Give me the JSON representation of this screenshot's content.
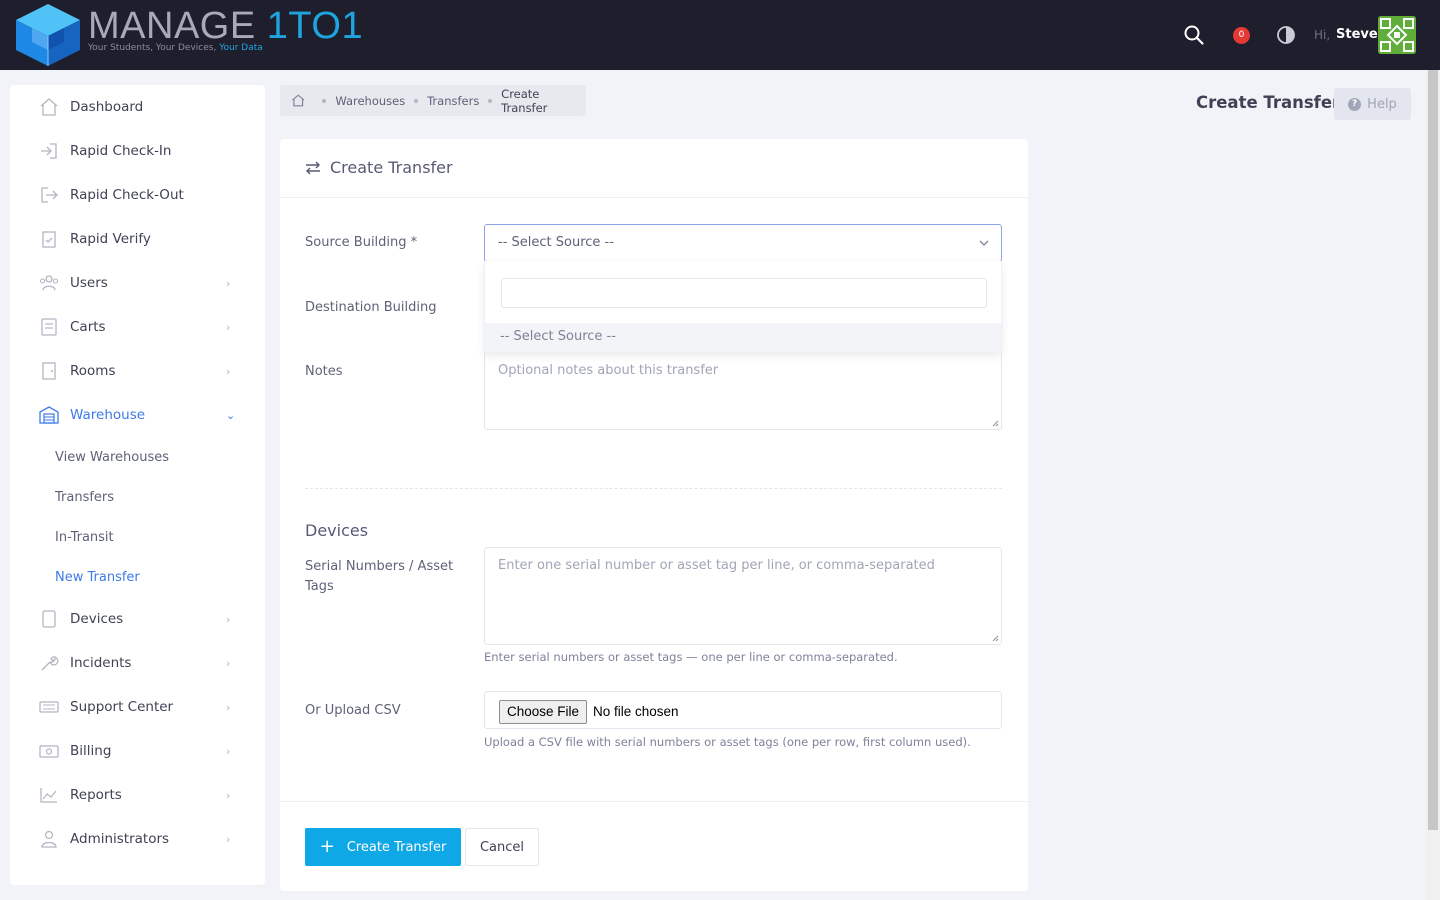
{
  "header": {
    "logo_main": "MANAGE",
    "logo_accent": "1TO1",
    "logo_tag": "Your Students, Your Devices,",
    "logo_tag_accent": "Your Data",
    "notification_count": "0",
    "greeting": "Hi,",
    "user_name": "Steve"
  },
  "sidebar": {
    "items": [
      {
        "label": "Dashboard",
        "icon": "home-icon"
      },
      {
        "label": "Rapid Check-In",
        "icon": "sign-in-icon"
      },
      {
        "label": "Rapid Check-Out",
        "icon": "sign-out-icon"
      },
      {
        "label": "Rapid Verify",
        "icon": "clipboard-check-icon"
      },
      {
        "label": "Users",
        "icon": "users-icon"
      },
      {
        "label": "Carts",
        "icon": "cart-icon"
      },
      {
        "label": "Rooms",
        "icon": "door-icon"
      },
      {
        "label": "Warehouse",
        "icon": "warehouse-icon"
      },
      {
        "label": "Devices",
        "icon": "tablet-icon"
      },
      {
        "label": "Incidents",
        "icon": "wrench-icon"
      },
      {
        "label": "Support Center",
        "icon": "ticket-icon"
      },
      {
        "label": "Billing",
        "icon": "money-icon"
      },
      {
        "label": "Reports",
        "icon": "chart-icon"
      },
      {
        "label": "Administrators",
        "icon": "admin-icon"
      }
    ],
    "warehouse_sub": [
      {
        "label": "View Warehouses"
      },
      {
        "label": "Transfers"
      },
      {
        "label": "In-Transit"
      },
      {
        "label": "New Transfer"
      }
    ]
  },
  "breadcrumb": {
    "items": [
      "Warehouses",
      "Transfers"
    ],
    "current": "Create Transfer"
  },
  "page": {
    "title": "Create Transfer",
    "help_label": "Help"
  },
  "form": {
    "card_title": "Create Transfer",
    "source_label": "Source Building *",
    "source_value": "-- Select Source --",
    "dropdown_option": "-- Select Source --",
    "destination_label": "Destination Building",
    "notes_label": "Notes",
    "notes_placeholder": "Optional notes about this transfer",
    "devices_title": "Devices",
    "serial_label_line1": "Serial Numbers / Asset",
    "serial_label_line2": "Tags",
    "serial_placeholder": "Enter one serial number or asset tag per line, or comma-separated",
    "serial_help": "Enter serial numbers or asset tags — one per line or comma-separated.",
    "csv_label": "Or Upload CSV",
    "file_button": "Choose File",
    "file_status": "No file chosen",
    "csv_help": "Upload a CSV file with serial numbers or asset tags (one per row, first column used).",
    "submit_label": "Create Transfer",
    "cancel_label": "Cancel"
  },
  "colors": {
    "accent": "#3d7be8",
    "primary_button": "#0fa8e6",
    "header_bg": "#1e1e2d",
    "badge": "#e53935"
  }
}
